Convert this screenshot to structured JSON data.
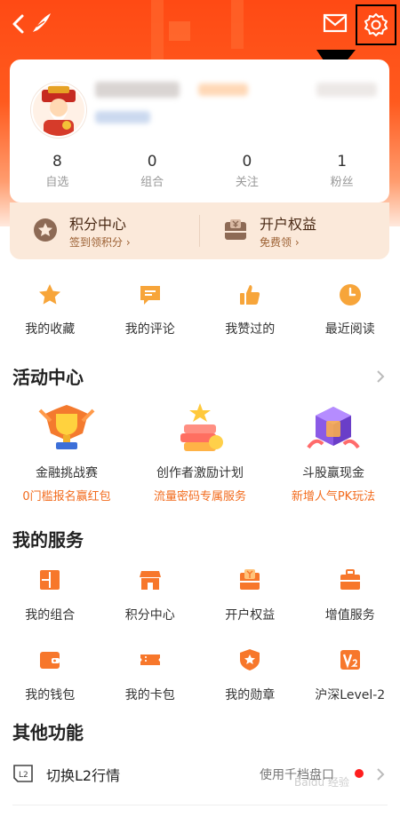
{
  "stats": [
    {
      "value": "8",
      "label": "自选"
    },
    {
      "value": "0",
      "label": "组合"
    },
    {
      "value": "0",
      "label": "关注"
    },
    {
      "value": "1",
      "label": "粉丝"
    }
  ],
  "perks": [
    {
      "title": "积分中心",
      "sub": "签到领积分 ›"
    },
    {
      "title": "开户权益",
      "sub": "免费领 ›"
    }
  ],
  "quick_links": [
    {
      "label": "我的收藏",
      "icon": "star-icon"
    },
    {
      "label": "我的评论",
      "icon": "comment-icon"
    },
    {
      "label": "我赞过的",
      "icon": "thumb-up-icon"
    },
    {
      "label": "最近阅读",
      "icon": "clock-icon"
    }
  ],
  "activity": {
    "title": "活动中心",
    "items": [
      {
        "title": "金融挑战赛",
        "sub": "0门槛报名赢红包",
        "icon": "trophy-icon"
      },
      {
        "title": "创作者激励计划",
        "sub": "流量密码专属服务",
        "icon": "books-icon"
      },
      {
        "title": "斗股赢现金",
        "sub": "新增人气PK玩法",
        "icon": "cube-icon"
      }
    ]
  },
  "services": {
    "title": "我的服务",
    "rows": [
      [
        {
          "label": "我的组合",
          "icon": "portfolio-icon"
        },
        {
          "label": "积分中心",
          "icon": "shop-icon"
        },
        {
          "label": "开户权益",
          "icon": "yuan-card-icon"
        },
        {
          "label": "增值服务",
          "icon": "briefcase-icon"
        }
      ],
      [
        {
          "label": "我的钱包",
          "icon": "wallet-icon"
        },
        {
          "label": "我的卡包",
          "icon": "ticket-icon"
        },
        {
          "label": "我的勋章",
          "icon": "medal-icon"
        },
        {
          "label": "沪深Level-2",
          "icon": "level2-icon"
        }
      ]
    ]
  },
  "other": {
    "title": "其他功能",
    "l2_label": "切换L2行情",
    "l2_value": "使用千档盘口"
  },
  "watermark": "Baidu 经验",
  "colors": {
    "accent": "#ff5a1e",
    "orange_text": "#f26b1d",
    "perk_bg": "#fbe9da"
  }
}
